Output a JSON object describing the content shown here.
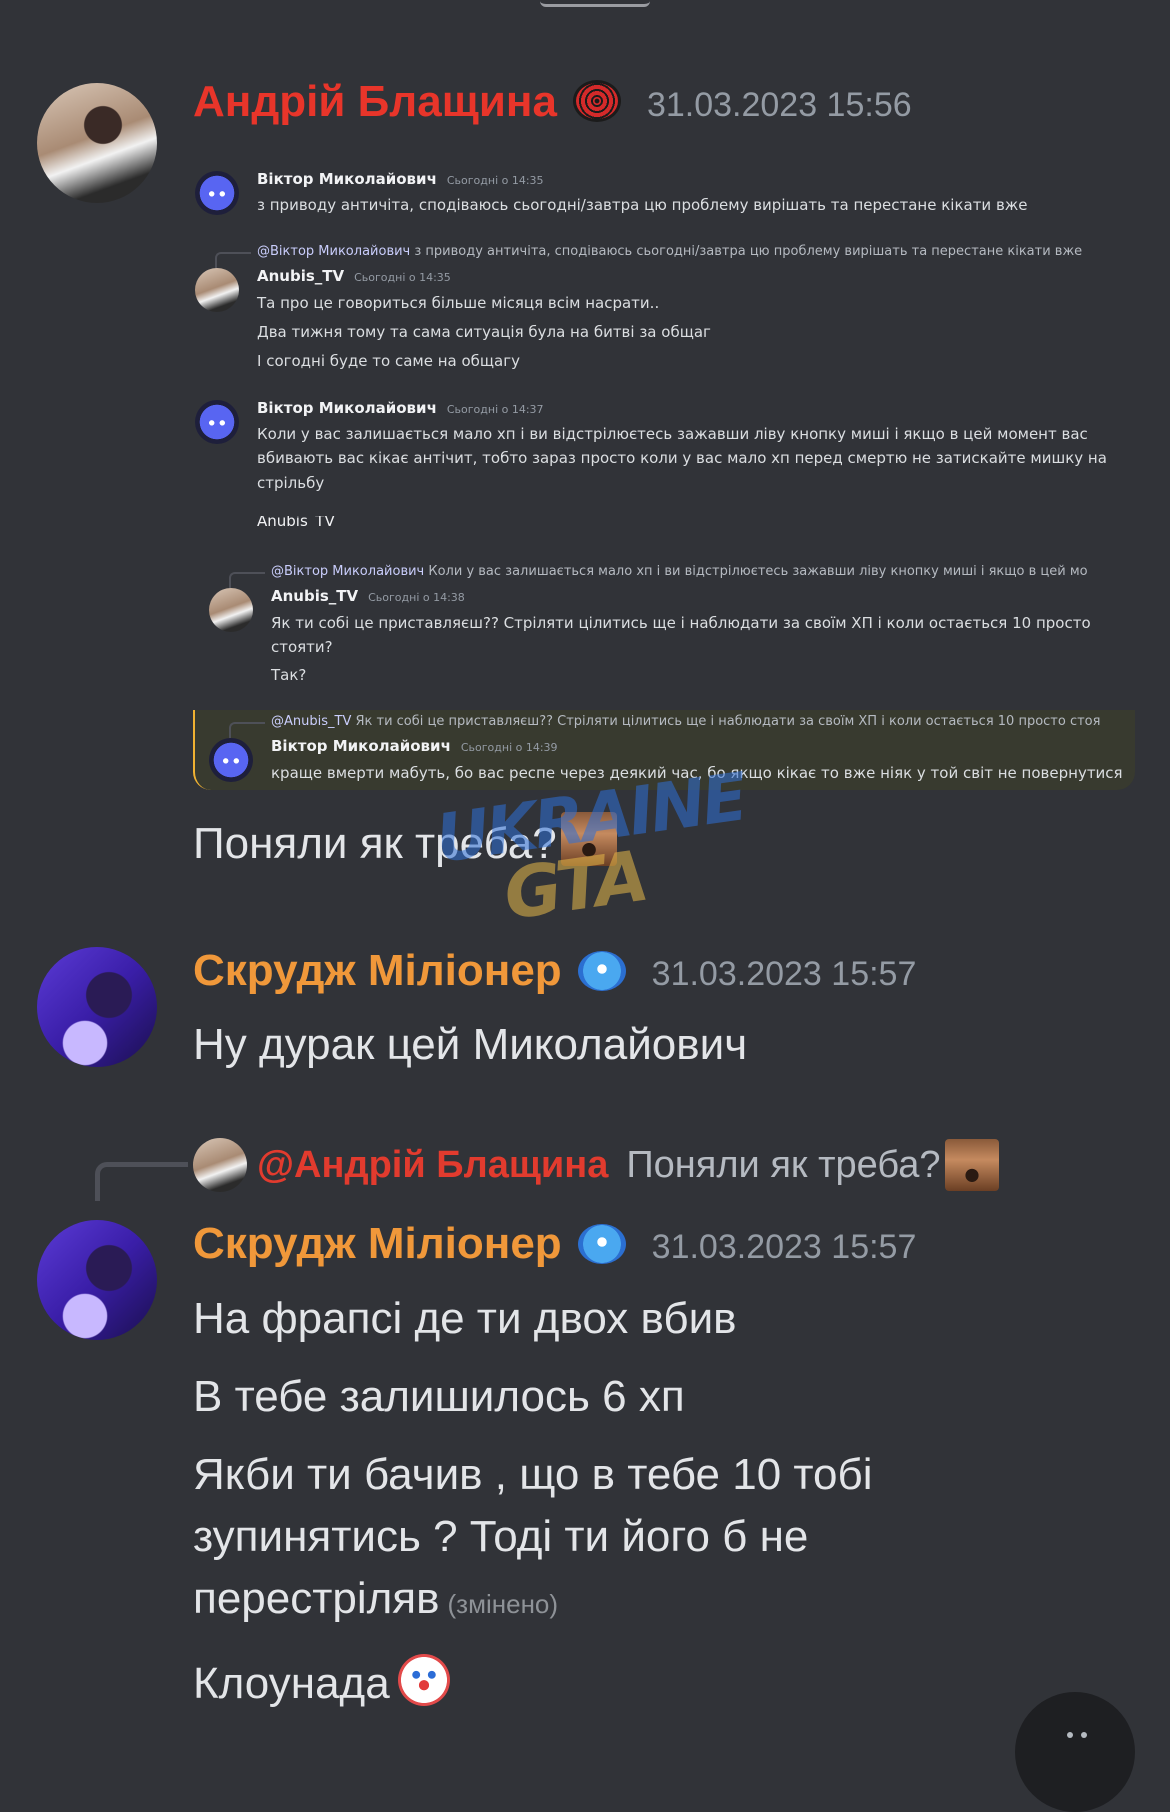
{
  "colors": {
    "background": "#313338",
    "user1_name": "#e8352a",
    "user2_name": "#f0983a",
    "timestamp": "#949ba4",
    "text": "#e3e5e8"
  },
  "messages": [
    {
      "author": "Андрій Блащина",
      "badge": "spider-emoji",
      "timestamp": "31.03.2023 15:56",
      "embedded_screenshot": {
        "m1": {
          "author": "Віктор Миколайович",
          "time": "Сьогодні о 14:35",
          "text": "з приводу античіта, сподіваюсь сьогодні/завтра цю проблему вирішать та перестане кікати вже"
        },
        "m2": {
          "reply_mention": "@Віктор Миколайович",
          "reply_text": "з приводу античіта, сподіваюсь сьогодні/завтра цю проблему вирішать та перестане кікати вже",
          "author": "Anubis_TV",
          "time": "Сьогодні о 14:35",
          "line1": "Та про це говориться більше місяця всім насрати..",
          "line2": "Два тижня тому та сама ситуація була на битві за общаг",
          "line3": "І согодні буде то саме на общагу"
        },
        "m3": {
          "author": "Віктор Миколайович",
          "time": "Сьогодні о 14:37",
          "line1": "Коли у вас залишається мало хп і ви відстрілюєтесь зажавши ліву кнопку миші і якщо в цей момент вас",
          "line2": "вбивають вас кікає антічит, тобто зараз просто коли у вас мало хп перед смертю не затискайте мишку на",
          "line3": "стрільбу"
        },
        "cut_text": "Anubis_TV",
        "m4": {
          "reply_mention": "@Віктор Миколайович",
          "reply_text": "Коли у вас залишається мало хп і ви відстрілюєтесь зажавши ліву кнопку миші і якщо в цей мо",
          "author": "Anubis_TV",
          "time": "Сьогодні о 14:38",
          "line1": "Як ти собі це приставляєш?? Стріляти цілитись ще і наблюдати за своїм ХП і коли остається 10 просто",
          "line2": "стояти?",
          "line3": "Так?"
        },
        "m5": {
          "reply_mention": "@Anubis_TV",
          "reply_text": "Як ти собі це приставляєш?? Стріляти цілитись ще і наблюдати за своїм ХП і коли остається 10 просто стоя",
          "author": "Віктор Миколайович",
          "time": "Сьогодні о 14:39",
          "text": "краще вмерти мабуть, бо вас респе через деякий час, бо якщо кікає то вже ніяк у той світ не повернутися"
        }
      },
      "text": "Поняли як треба?"
    },
    {
      "author": "Скрудж Міліонер",
      "badge": "blue-face-emoji",
      "timestamp": "31.03.2023 15:57",
      "text": "Ну дурак цей Миколайович"
    },
    {
      "reply": {
        "mention": "@Андрій Блащина",
        "text": "Поняли як треба?"
      },
      "author": "Скрудж Міліонер",
      "badge": "blue-face-emoji",
      "timestamp": "31.03.2023 15:57",
      "line1": "На фрапсі де ти двох вбив",
      "line2": "В тебе залишилось 6 хп",
      "line3a": "Якби ти бачив , що в тебе 10 тобі",
      "line3b": "зупинятись ? Тоді ти його б не",
      "line3c": "перестріляв",
      "edited": "(змінено)",
      "line4": "Клоунада"
    }
  ],
  "watermark": {
    "line1": "UKRAINE",
    "line2": "GTA"
  }
}
